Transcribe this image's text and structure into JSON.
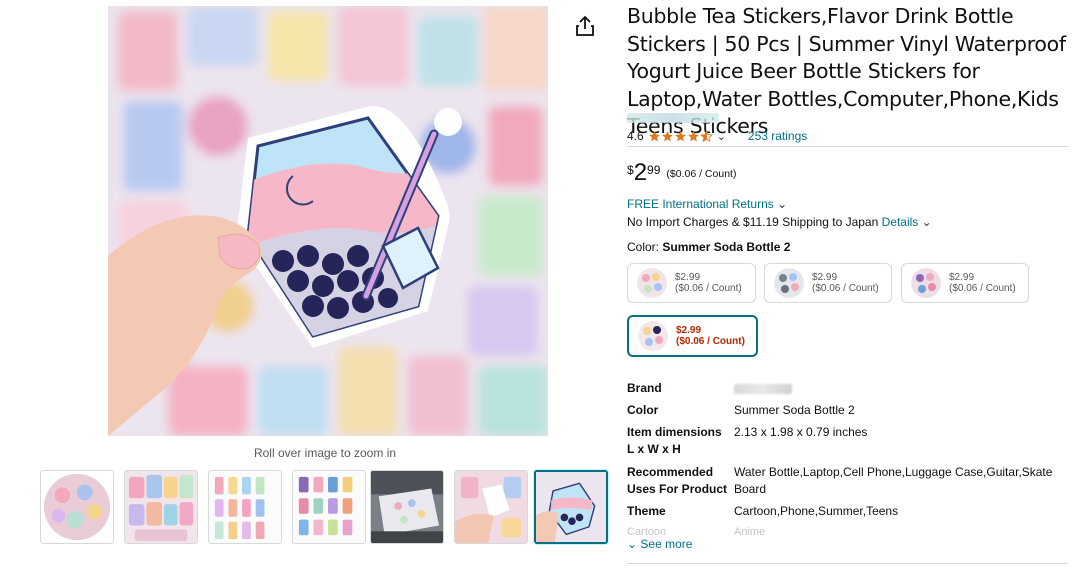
{
  "product": {
    "title": "Bubble Tea Stickers,Flavor Drink Bottle Stickers | 50 Pcs | Summer Vinyl Waterproof Yogurt Juice Beer Bottle Stickers for Laptop,Water Bottles,Computer,Phone,Kids Teens Stickers",
    "rating_value": "4.6",
    "rating_stars": 4.6,
    "ratings_count": "253 ratings"
  },
  "gallery": {
    "zoom_hint": "Roll over image to zoom in",
    "thumbnail_count": 7,
    "selected_index": 6
  },
  "price": {
    "symbol": "$",
    "whole": "2",
    "fraction": "99",
    "per_unit": "($0.06 / Count)"
  },
  "delivery": {
    "returns": "FREE International Returns",
    "shipping": "No Import Charges & $11.19 Shipping to Japan",
    "details_link": "Details"
  },
  "variation": {
    "label": "Color:",
    "selected_name": "Summer Soda Bottle 2",
    "options": [
      {
        "price": "$2.99",
        "unit": "($0.06 / Count)"
      },
      {
        "price": "$2.99",
        "unit": "($0.06 / Count)"
      },
      {
        "price": "$2.99",
        "unit": "($0.06 / Count)"
      },
      {
        "price": "$2.99",
        "unit": "($0.06 / Count)"
      }
    ]
  },
  "specs": [
    {
      "key": "Brand",
      "value": ""
    },
    {
      "key": "Color",
      "value": "Summer Soda Bottle 2"
    },
    {
      "key": "Item dimensions L x W x H",
      "value": "2.13 x 1.98 x 0.79 inches"
    },
    {
      "key": "Recommended Uses For Product",
      "value": "Water Bottle,Laptop,Cell Phone,Luggage Case,Guitar,Skate Board"
    },
    {
      "key": "Theme",
      "value": "Cartoon,Phone,Summer,Teens"
    }
  ],
  "specs_fade": {
    "key": "Cartoon",
    "value": "Anime"
  },
  "see_more": "See more",
  "colors": {
    "link": "#007185",
    "star": "#de7921",
    "price_red": "#b12704",
    "divider": "#d5d9d9"
  }
}
